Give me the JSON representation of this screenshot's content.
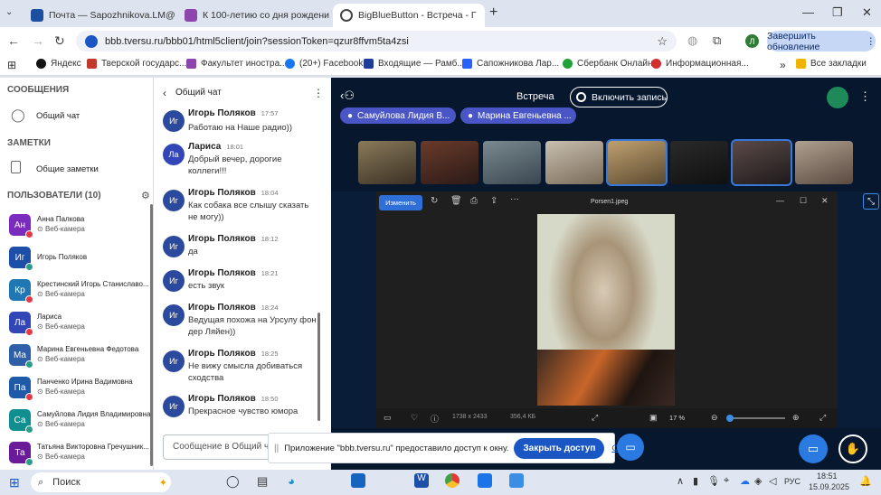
{
  "browser": {
    "tabs": [
      {
        "title": "Почта — Sapozhnikova.LM@t",
        "active": false
      },
      {
        "title": "К 100-летию со дня рождени",
        "active": false
      },
      {
        "title": "BigBlueButton - Встреча - Г",
        "active": true
      }
    ],
    "new_tab": "+",
    "url": "bbb.tversu.ru/bbb01/html5client/join?sessionToken=qzur8ffvm5ta4zsi",
    "update_label": "Завершить обновление",
    "profile_initial": "Л",
    "bookmarks": [
      {
        "label": "Яндекс",
        "color": "#111111"
      },
      {
        "label": "Тверской государс...",
        "color": "#c0392b"
      },
      {
        "label": "Факультет иностра...",
        "color": "#8e44ad"
      },
      {
        "label": "(20+) Facebook",
        "color": "#1877f2"
      },
      {
        "label": "Входящие — Рамб...",
        "color": "#1c3d99"
      },
      {
        "label": "Сапожникова Лар...",
        "color": "#2962ff"
      },
      {
        "label": "Сбербанк Онлайн",
        "color": "#21a038"
      },
      {
        "label": "Информационная...",
        "color": "#d32f2f"
      }
    ],
    "all_bookmarks": "Все закладки"
  },
  "sidebar": {
    "messages_heading": "СООБЩЕНИЯ",
    "public_chat": "Общий чат",
    "notes_heading": "ЗАМЕТКИ",
    "shared_notes": "Общие заметки",
    "users_heading": "ПОЛЬЗОВАТЕЛИ (10)",
    "users": [
      {
        "initials": "Ан",
        "name": "Анна Палкова",
        "sub": "Веб-камера",
        "color": "#7b2cbf",
        "status": "#e63946"
      },
      {
        "initials": "Иг",
        "name": "Игорь Поляков",
        "sub": "",
        "color": "#1e4fa8",
        "status": "#2a9d8f"
      },
      {
        "initials": "Кр",
        "name": "Крестинский Игорь Станиславо...",
        "sub": "Веб-камера",
        "color": "#1f78b4",
        "status": "#e63946"
      },
      {
        "initials": "Ла",
        "name": "Лариса",
        "sub": "Веб-камера",
        "color": "#3346b8",
        "status": "#e63946"
      },
      {
        "initials": "Ма",
        "name": "Марина Евгеньевна Федотова",
        "sub": "Веб-камера",
        "color": "#2f5fa8",
        "status": "#2a9d8f"
      },
      {
        "initials": "Па",
        "name": "Панченко Ирина Вадимовна",
        "sub": "Веб-камера",
        "color": "#1e5aa8",
        "status": "#e63946"
      },
      {
        "initials": "Са",
        "name": "Самуйлова Лидия Владимировна",
        "sub": "Веб-камера",
        "color": "#0f8f8f",
        "status": "#2a9d8f"
      },
      {
        "initials": "Та",
        "name": "Татьяна Викторовна Гречушник...",
        "sub": "Веб-камера",
        "color": "#6a1b9a",
        "status": "#2a9d8f"
      }
    ]
  },
  "chat": {
    "title": "Общий чат",
    "messages": [
      {
        "initials": "Иг",
        "name": "Игорь Поляков",
        "time": "17:57",
        "text": "Работаю на Наше радио))"
      },
      {
        "initials": "Ла",
        "name": "Лариса",
        "time": "18:01",
        "text": "Добрый вечер, дорогие коллеги!!!"
      },
      {
        "initials": "Иг",
        "name": "Игорь Поляков",
        "time": "18:04",
        "text": "Как собака все слышу сказать не могу))"
      },
      {
        "initials": "Иг",
        "name": "Игорь Поляков",
        "time": "18:12",
        "text": "да"
      },
      {
        "initials": "Иг",
        "name": "Игорь Поляков",
        "time": "18:21",
        "text": "есть звук"
      },
      {
        "initials": "Иг",
        "name": "Игорь Поляков",
        "time": "18:24",
        "text": "Ведущая похожа на Урсулу фон дер Ляйен))"
      },
      {
        "initials": "Иг",
        "name": "Игорь Поляков",
        "time": "18:25",
        "text": "Не вижу смысла добиваться сходства"
      },
      {
        "initials": "Иг",
        "name": "Игорь Поляков",
        "time": "18:50",
        "text": "Прекрасное чувство юмора"
      }
    ],
    "input_placeholder": "Сообщение в Общий ча"
  },
  "meeting": {
    "title": "Встреча",
    "record_label": "Включить запись",
    "talkers": [
      "Самуйлова Лидия В...",
      "Марина Евгеньевна ..."
    ]
  },
  "viewer": {
    "edit_label": "Изменить",
    "filename": "Porsen1.jpeg",
    "dimensions": "1738 x 2433",
    "filesize": "356,4 КБ",
    "zoom": "17 %"
  },
  "share_notice": {
    "text": "Приложение \"bbb.tversu.ru\" предоставило доступ к окну.",
    "stop_label": "Закрыть доступ",
    "hide_label": "Скрыть"
  },
  "taskbar": {
    "search": "Поиск",
    "lang": "РУС",
    "time": "18:51",
    "date": "15.09.2025"
  }
}
